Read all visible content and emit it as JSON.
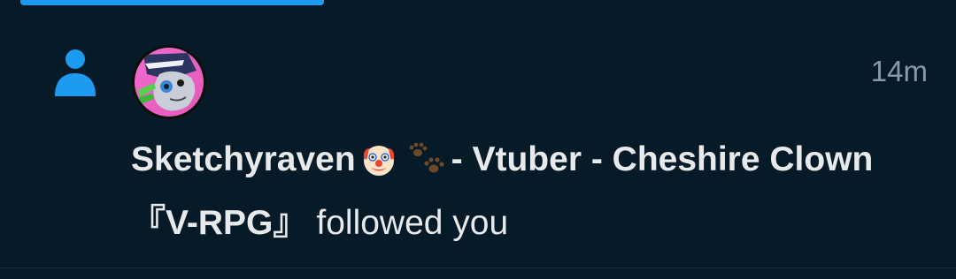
{
  "notification": {
    "icon": "person-icon",
    "avatar": "user-avatar",
    "timestamp": "14m",
    "display_name_part1": "Sketchyraven",
    "emoji1": "clown-face-emoji",
    "emoji2": "paw-prints-emoji",
    "display_name_part2": "- Vtuber - Cheshire Clown『V-RPG』",
    "action": "followed you",
    "colors": {
      "background": "#071a28",
      "accent": "#1d9bf0",
      "text": "#e7e9ea",
      "muted": "#8b98a5"
    }
  }
}
